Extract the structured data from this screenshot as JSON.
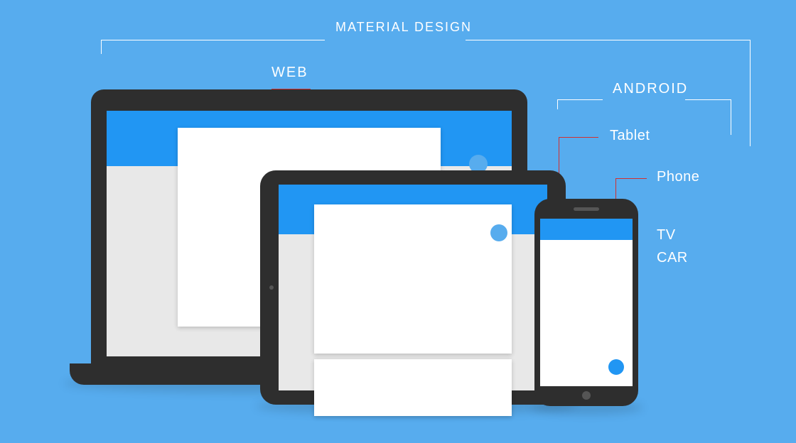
{
  "title": "MATERIAL DESIGN",
  "categories": {
    "web": "WEB",
    "android": "ANDROID"
  },
  "devices": {
    "tablet": "Tablet",
    "phone": "Phone",
    "tv": "TV",
    "car": "CAR"
  },
  "colors": {
    "bg": "#57ACEE",
    "primary": "#2196F3",
    "frame": "#2E2E2E",
    "leader": "#D32F2F"
  }
}
